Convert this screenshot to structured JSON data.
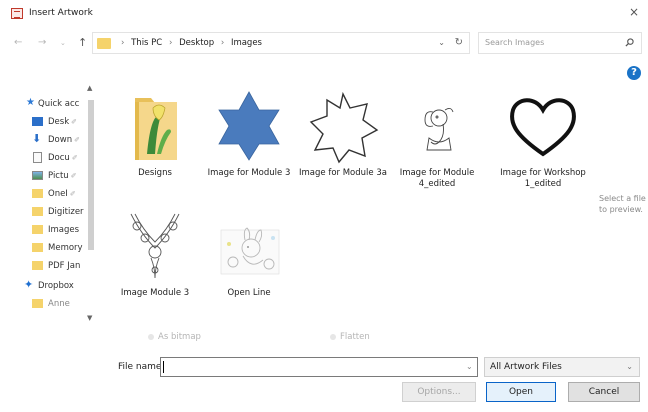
{
  "window": {
    "title": "Insert Artwork",
    "close_glyph": "×",
    "help_glyph": "?"
  },
  "address": {
    "crumbs": [
      "This PC",
      "Desktop",
      "Images"
    ],
    "separator": "›",
    "search_placeholder": "Search Images"
  },
  "nav": {
    "items": [
      {
        "label": "Quick acc",
        "pinned": false,
        "icon": "star-icon"
      },
      {
        "label": "Desk",
        "pinned": true,
        "icon": "desktop-icon"
      },
      {
        "label": "Down",
        "pinned": true,
        "icon": "download-icon"
      },
      {
        "label": "Docu",
        "pinned": true,
        "icon": "document-icon"
      },
      {
        "label": "Pictu",
        "pinned": true,
        "icon": "pictures-icon"
      },
      {
        "label": "OneI",
        "pinned": true,
        "icon": "folder-icon"
      },
      {
        "label": "Digitizer",
        "pinned": false,
        "icon": "folder-icon"
      },
      {
        "label": "Images",
        "pinned": false,
        "icon": "folder-icon"
      },
      {
        "label": "Memory",
        "pinned": false,
        "icon": "folder-icon"
      },
      {
        "label": "PDF Jan",
        "pinned": false,
        "icon": "folder-icon"
      },
      {
        "label": "Dropbox",
        "pinned": false,
        "icon": "dropbox-icon"
      },
      {
        "label": "Anne",
        "pinned": false,
        "icon": "folder-icon"
      }
    ],
    "pin_glyph": "✐"
  },
  "files": [
    {
      "name": "Designs",
      "kind": "folder"
    },
    {
      "name": "Image for Module 3",
      "kind": "star6"
    },
    {
      "name": "Image for Module 3a",
      "kind": "star7"
    },
    {
      "name": "Image for Module 4_edited",
      "kind": "elephant"
    },
    {
      "name": "Image for Workshop 1_edited",
      "kind": "heart"
    },
    {
      "name": "Image Module 3",
      "kind": "lace"
    },
    {
      "name": "Open Line",
      "kind": "bunny"
    }
  ],
  "preview_hint": "Select a file to preview.",
  "options": {
    "as_bitmap": "As bitmap",
    "flatten": "Flatten"
  },
  "filename": {
    "label": "File name:",
    "value": ""
  },
  "filetype": {
    "selected": "All Artwork Files"
  },
  "buttons": {
    "options": "Options...",
    "open": "Open",
    "cancel": "Cancel"
  },
  "colors": {
    "star_fill": "#4a7bbd",
    "accent": "#0a64c8",
    "folder": "#f5d36b"
  }
}
